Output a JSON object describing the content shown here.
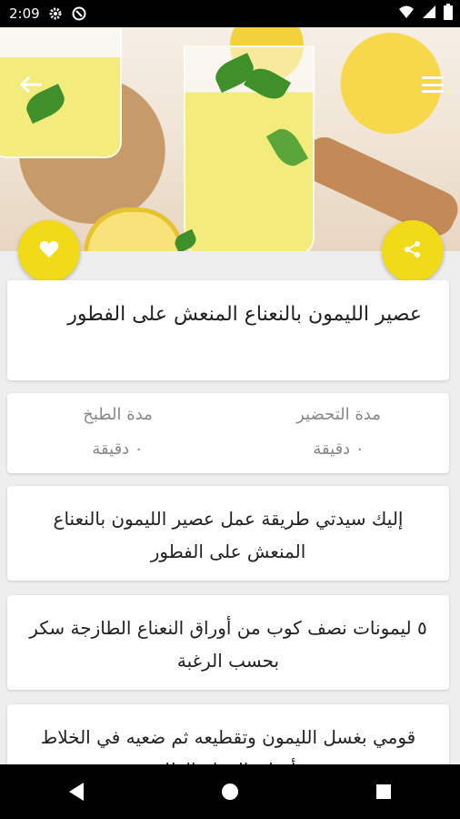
{
  "status_bar": {
    "time": "2:09",
    "icons": [
      "settings-icon",
      "vpn-icon",
      "wifi-icon",
      "signal-icon",
      "battery-icon"
    ]
  },
  "hero": {
    "description_icons": [
      "back-arrow-icon",
      "menu-icon"
    ]
  },
  "actions": {
    "favorite_icon": "heart-icon",
    "share_icon": "share-icon"
  },
  "recipe": {
    "title": "عصير الليمون بالنعناع المنعش على الفطور",
    "prep_label": "مدة التحضير",
    "prep_value": "٠ دقيقة",
    "cook_label": "مدة الطبخ",
    "cook_value": "٠ دقيقة",
    "description": "إليك سيدتي طريقة عمل عصير الليمون بالنعناع المنعش على الفطور",
    "ingredients": "٥ ليمونات نصف كوب من أوراق النعناع الطازجة سكر بحسب الرغبة",
    "steps": "قومي بغسل الليمون وتقطيعه ثم ضعيه في الخلاط مع أوراق النعناع الطازجة"
  },
  "colors": {
    "accent": "#f1da17",
    "background": "#eeeeee"
  },
  "nav": [
    "back-icon",
    "home-icon",
    "recents-icon"
  ]
}
